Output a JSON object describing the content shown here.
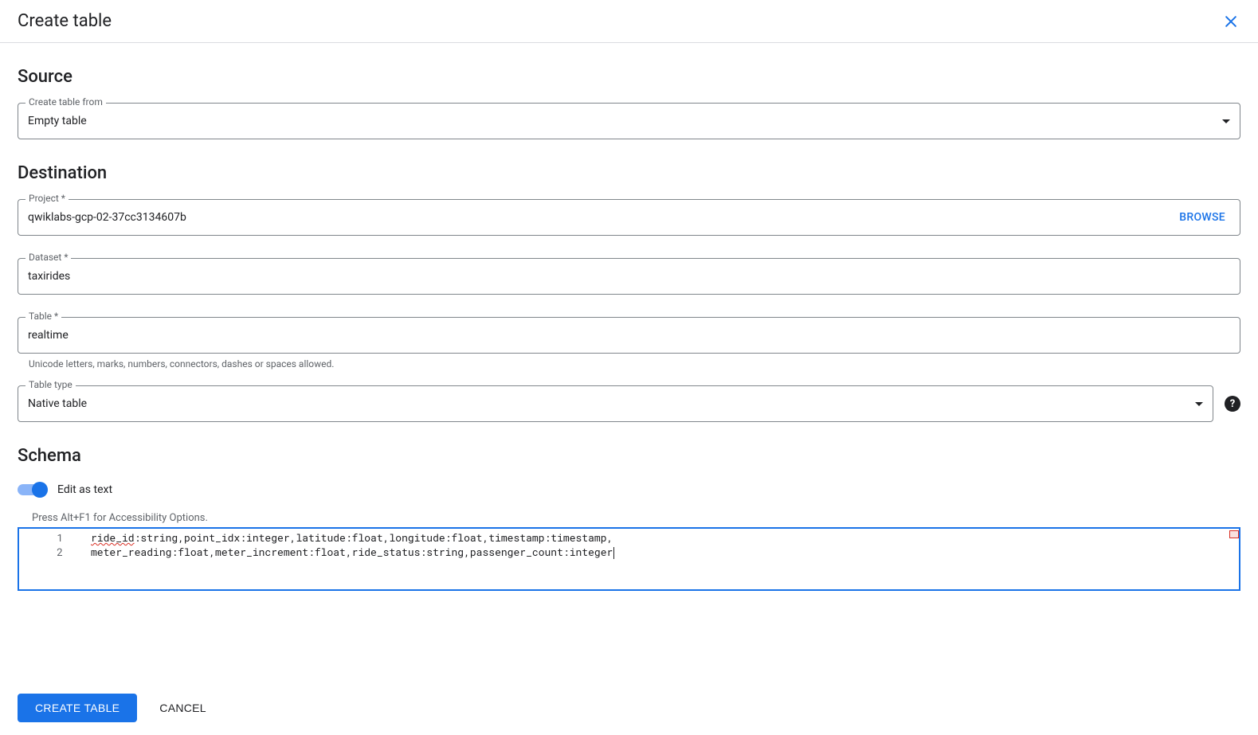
{
  "header": {
    "title": "Create table"
  },
  "source": {
    "section_title": "Source",
    "create_from_label": "Create table from",
    "create_from_value": "Empty table"
  },
  "destination": {
    "section_title": "Destination",
    "project_label": "Project *",
    "project_value": "qwiklabs-gcp-02-37cc3134607b",
    "browse_label": "BROWSE",
    "dataset_label": "Dataset *",
    "dataset_value": "taxirides",
    "table_label": "Table *",
    "table_value": "realtime",
    "table_helper": "Unicode letters, marks, numbers, connectors, dashes or spaces allowed.",
    "table_type_label": "Table type",
    "table_type_value": "Native table"
  },
  "schema": {
    "section_title": "Schema",
    "edit_as_text_label": "Edit as text",
    "a11y_hint": "Press Alt+F1 for Accessibility Options.",
    "code_lines": {
      "l1_pre": "ride_id",
      "l1_post": ":string,point_idx:integer,latitude:float,longitude:float,timestamp:timestamp,",
      "l2": "meter_reading:float,meter_increment:float,ride_status:string,passenger_count:integer"
    },
    "line_numbers": {
      "n1": "1",
      "n2": "2"
    }
  },
  "footer": {
    "create_label": "CREATE TABLE",
    "cancel_label": "CANCEL"
  }
}
